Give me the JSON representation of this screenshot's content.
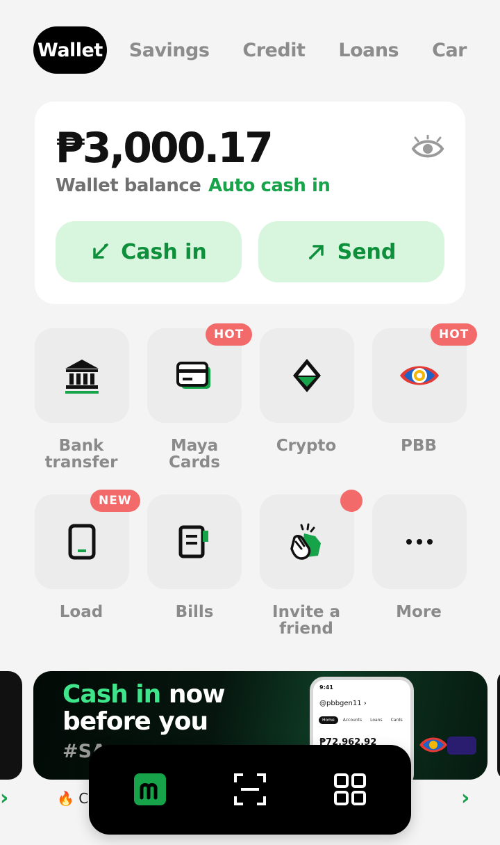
{
  "tabs": [
    "Wallet",
    "Savings",
    "Credit",
    "Loans",
    "Car"
  ],
  "balance": {
    "amount": "₱3,000.17",
    "label": "Wallet balance",
    "auto_cash_in": "Auto cash in",
    "cash_in": "Cash in",
    "send": "Send"
  },
  "services": [
    {
      "label_l1": "Bank",
      "label_l2": "transfer",
      "badge": ""
    },
    {
      "label_l1": "Maya",
      "label_l2": "Cards",
      "badge": "HOT"
    },
    {
      "label_l1": "Crypto",
      "label_l2": "",
      "badge": ""
    },
    {
      "label_l1": "PBB",
      "label_l2": "",
      "badge": "HOT"
    },
    {
      "label_l1": "Load",
      "label_l2": "",
      "badge": "NEW"
    },
    {
      "label_l1": "Bills",
      "label_l2": "",
      "badge": ""
    },
    {
      "label_l1": "Invite a",
      "label_l2": "friend",
      "badge": ""
    },
    {
      "label_l1": "More",
      "label_l2": "",
      "badge": ""
    }
  ],
  "banner": {
    "green": "Cash in",
    "line1_rest": "now",
    "line2": "before you",
    "line3": "#SA",
    "phone_time": "9:41",
    "phone_user": "@pbbgen11 ›",
    "phone_tabs": [
      "Home",
      "Accounts",
      "Loans",
      "Cards"
    ],
    "phone_amount": "₱72,962.92"
  },
  "caption": "Co",
  "colors": {
    "accent": "#16a34a",
    "badge": "#f26a6a",
    "nav_bg": "#000000"
  },
  "nav": [
    "maya-home-icon",
    "scan-icon",
    "apps-grid-icon"
  ]
}
